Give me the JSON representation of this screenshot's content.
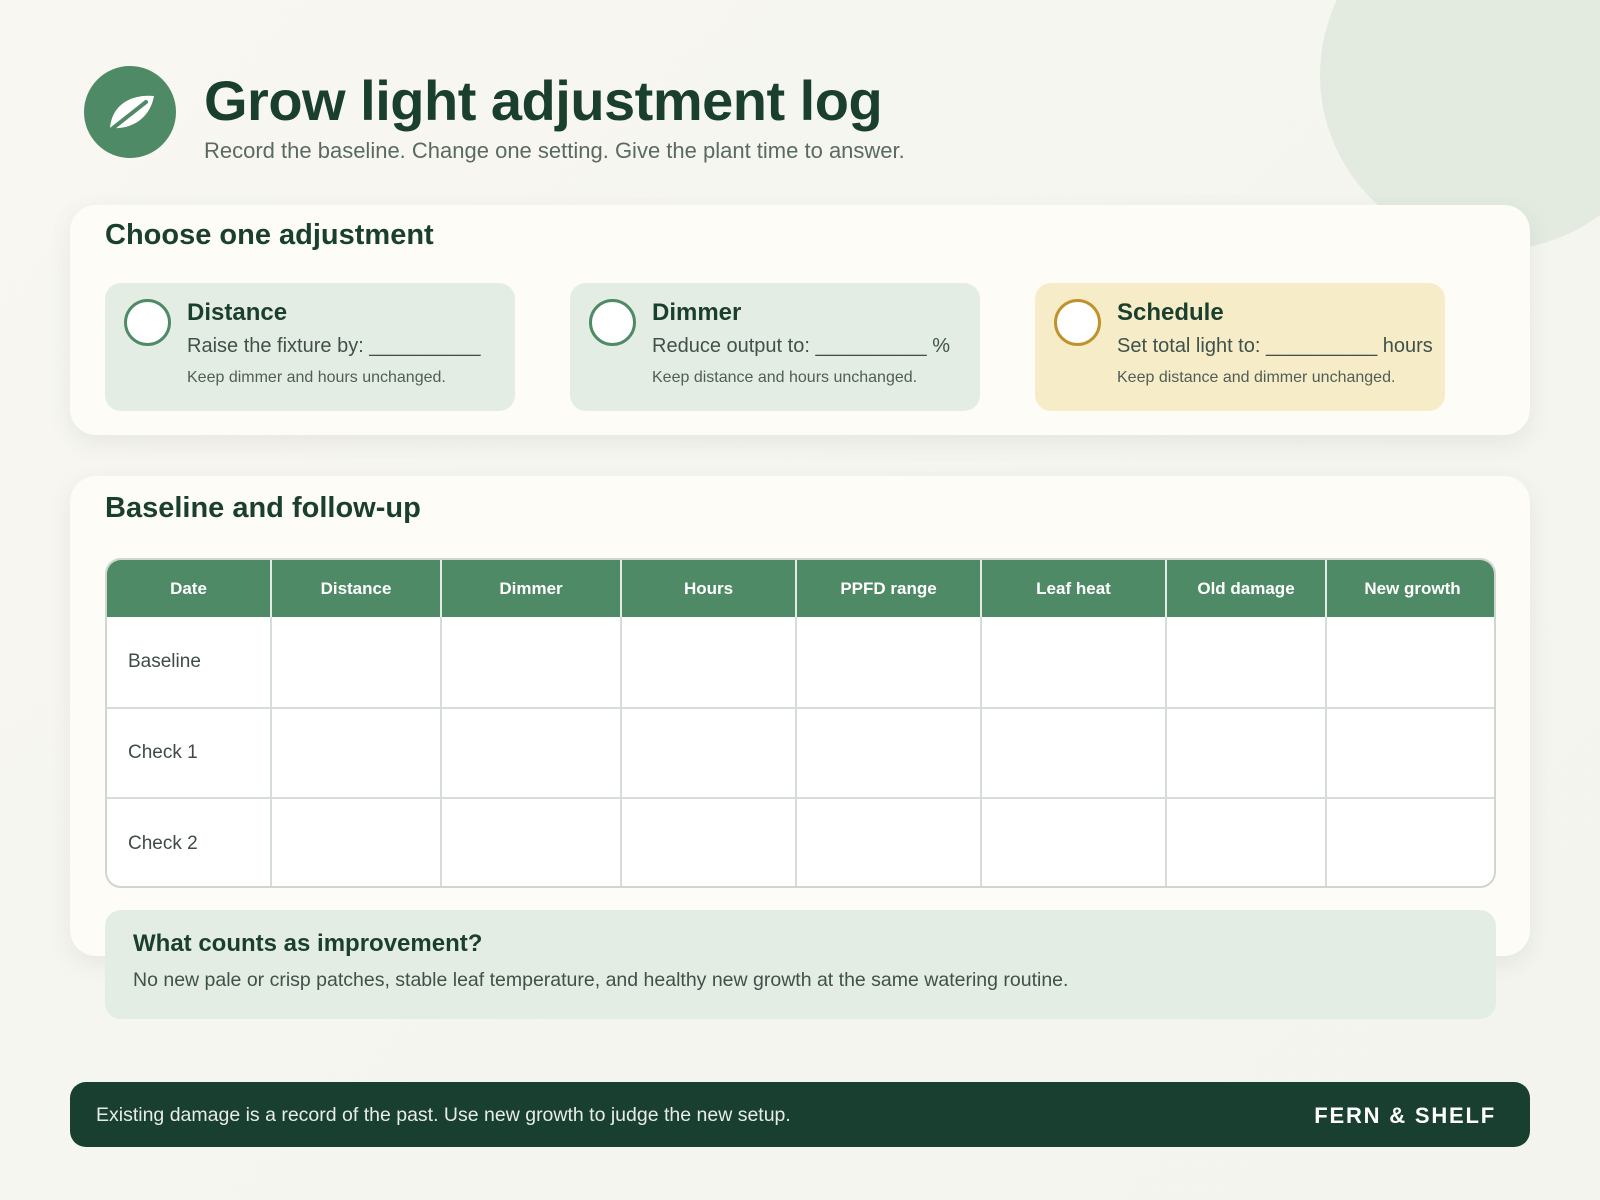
{
  "header": {
    "logo_icon": "leaf-icon",
    "title": "Grow light adjustment log",
    "subtitle": "Record the baseline. Change one setting. Give the plant time to answer."
  },
  "adjustment": {
    "title": "Choose one adjustment",
    "options": [
      {
        "name": "Distance",
        "line": "Raise the fixture by: __________",
        "note": "Keep dimmer and hours unchanged."
      },
      {
        "name": "Dimmer",
        "line": "Reduce output to: __________ %",
        "note": "Keep distance and hours unchanged."
      },
      {
        "name": "Schedule",
        "line": "Set total light to: __________ hours",
        "note": "Keep distance and dimmer unchanged."
      }
    ]
  },
  "log": {
    "title": "Baseline and follow-up",
    "columns": [
      "Date",
      "Distance",
      "Dimmer",
      "Hours",
      "PPFD range",
      "Leaf heat",
      "Old damage",
      "New growth"
    ],
    "rows": [
      "Baseline",
      "Check 1",
      "Check 2"
    ]
  },
  "improvement": {
    "title": "What counts as improvement?",
    "text": "No new pale or crisp patches, stable leaf temperature, and healthy new growth at the same watering routine."
  },
  "footer": {
    "text": "Existing damage is a record of the past. Use new growth to judge the new setup.",
    "brand": "FERN & SHELF"
  },
  "colors": {
    "primary_green": "#4f8a66",
    "dark_green": "#183f30",
    "option_highlight": "#f7ecc8"
  }
}
